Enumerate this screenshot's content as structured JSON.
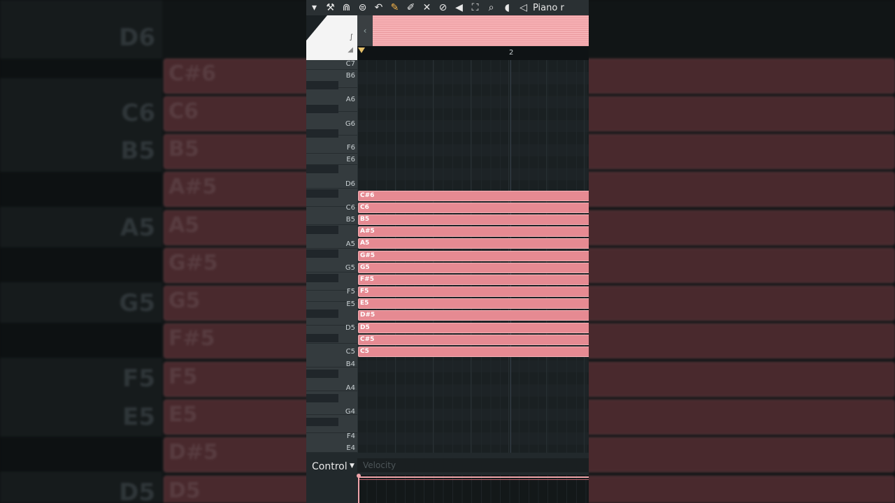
{
  "toolbar": {
    "title": "Piano r",
    "icons": [
      "menu-arrow-icon",
      "wrench-icon",
      "magnet-icon",
      "list-icon",
      "undo-icon",
      "pencil-icon",
      "paint-brush-icon",
      "delete-icon",
      "mute-icon",
      "slice-icon",
      "select-icon",
      "zoom-icon",
      "playback-icon",
      "speaker-icon"
    ]
  },
  "ruler": {
    "bar_label": "2"
  },
  "keyboard": {
    "labels": [
      "C7",
      "B6",
      "A6",
      "G6",
      "F6",
      "E6",
      "D6",
      "C6",
      "B5",
      "A5",
      "G5",
      "F5",
      "E5",
      "D5",
      "C5",
      "B4",
      "A4",
      "G4",
      "F4",
      "E4"
    ]
  },
  "notes": [
    "C#6",
    "C6",
    "B5",
    "A#5",
    "A5",
    "G#5",
    "G5",
    "F#5",
    "F5",
    "E5",
    "D#5",
    "D5",
    "C#5",
    "C5"
  ],
  "control": {
    "label": "Control",
    "tab": "Velocity"
  },
  "background": {
    "key_labels": [
      "D6",
      "C6",
      "B5",
      "A5",
      "G5",
      "F5",
      "E5",
      "D5"
    ],
    "note_labels": [
      "C#6",
      "C6",
      "B5",
      "A#5",
      "A5",
      "G#5",
      "G5",
      "F#5",
      "F5",
      "E5",
      "D#5",
      "D5"
    ]
  },
  "colors": {
    "note": "#e68a92",
    "overview": "#f7b2b6",
    "accent": "#f3b24a"
  }
}
